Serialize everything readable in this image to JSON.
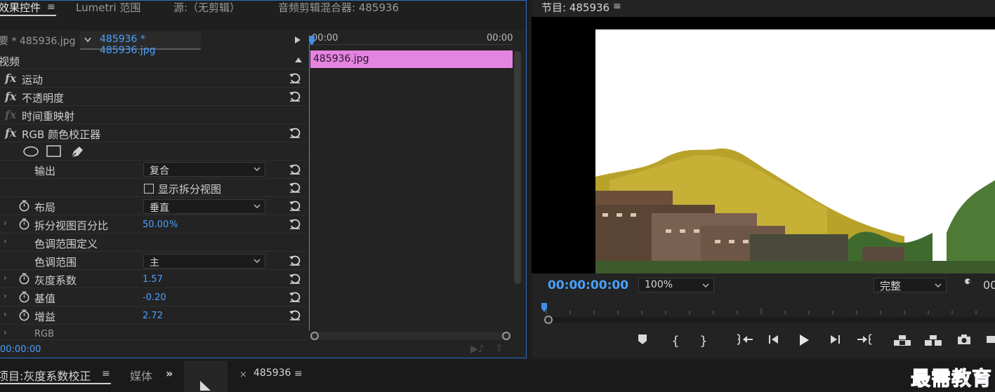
{
  "effects_panel": {
    "tabs": [
      "效果控件",
      "Lumetri 范围",
      "源:（无剪辑）",
      "音频剪辑混合器: 485936"
    ],
    "source_label": "要 * 485936.jpg",
    "clip_label": "485936 * 485936.jpg",
    "timeline_start": "00:00",
    "timeline_end": "00:00",
    "clip_name": "485936.jpg",
    "section_video": "视频",
    "effects": [
      {
        "label": "运动"
      },
      {
        "label": "不透明度"
      },
      {
        "label": "时间重映射"
      },
      {
        "label": "RGB 颜色校正器"
      }
    ],
    "params": {
      "output_label": "输出",
      "output_value": "复合",
      "split_view_label": "显示拆分视图",
      "layout_label": "布局",
      "layout_value": "垂直",
      "split_pct_label": "拆分视图百分比",
      "split_pct_value": "50.00",
      "split_pct_unit": "%",
      "tonal_def_label": "色调范围定义",
      "tonal_range_label": "色调范围",
      "tonal_range_value": "主",
      "gamma_label": "灰度系数",
      "gamma_value": "1.57",
      "pedestal_label": "基值",
      "pedestal_value": "-0.20",
      "gain_label": "增益",
      "gain_value": "2.72",
      "rgb_label": "RGB"
    },
    "timecode": "00:00:00"
  },
  "program": {
    "title": "节目: 485936",
    "timecode": "00:00:00:00",
    "zoom": "100%",
    "quality": "完整",
    "right_timecode_partial": "00"
  },
  "bottom": {
    "project_tab": "项目:灰度系数校正",
    "media_tab": "媒体",
    "overflow": "»",
    "timeline_tab": "485936"
  },
  "watermark": "最需教育",
  "colors": {
    "accent": "#4aa0ff",
    "clip": "#e384e0",
    "panel": "#232323"
  }
}
